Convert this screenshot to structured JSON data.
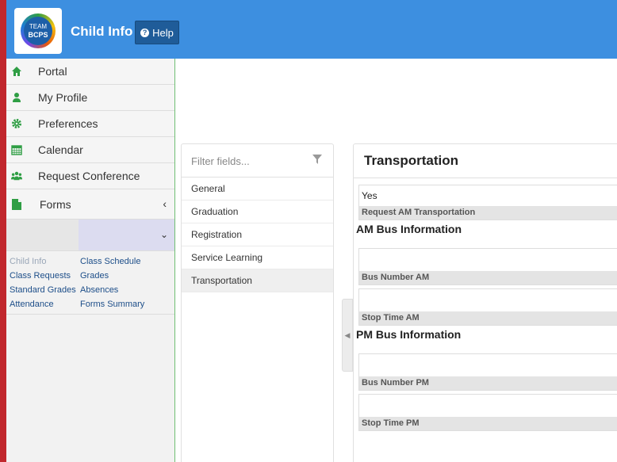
{
  "header": {
    "logo_top": "TEAM",
    "logo_bottom": "BCPS",
    "title": "Child Info",
    "help_label": "Help"
  },
  "sidebar": {
    "nav": [
      {
        "label": "Portal",
        "icon": "home-icon"
      },
      {
        "label": "My Profile",
        "icon": "user-icon"
      },
      {
        "label": "Preferences",
        "icon": "gear-icon"
      },
      {
        "label": "Calendar",
        "icon": "calendar-icon"
      },
      {
        "label": "Request Conference",
        "icon": "users-icon"
      },
      {
        "label": "Forms",
        "icon": "file-icon"
      }
    ],
    "links": [
      {
        "label": "Child Info",
        "muted": true
      },
      {
        "label": "Class Schedule"
      },
      {
        "label": "Class Requests"
      },
      {
        "label": "Grades"
      },
      {
        "label": "Standard Grades"
      },
      {
        "label": "Absences"
      },
      {
        "label": "Attendance"
      },
      {
        "label": "Forms Summary"
      }
    ]
  },
  "filter": {
    "placeholder": "Filter fields...",
    "items": [
      "General",
      "Graduation",
      "Registration",
      "Service Learning",
      "Transportation"
    ],
    "active_index": 4
  },
  "transportation": {
    "title": "Transportation",
    "request_am": {
      "value": "Yes",
      "label": "Request AM Transportation"
    },
    "am_section": "AM Bus Information",
    "bus_number_am": {
      "value": "",
      "label": "Bus Number AM"
    },
    "stop_time_am": {
      "value": "",
      "label": "Stop Time AM"
    },
    "pm_section": "PM Bus Information",
    "bus_number_pm": {
      "value": "",
      "label": "Bus Number PM"
    },
    "stop_time_pm": {
      "value": "",
      "label": "Stop Time PM"
    }
  },
  "colors": {
    "header": "#3d8fe0",
    "accent_red": "#c1272d",
    "icon_green": "#2f9e44",
    "link_blue": "#1d4e89"
  }
}
